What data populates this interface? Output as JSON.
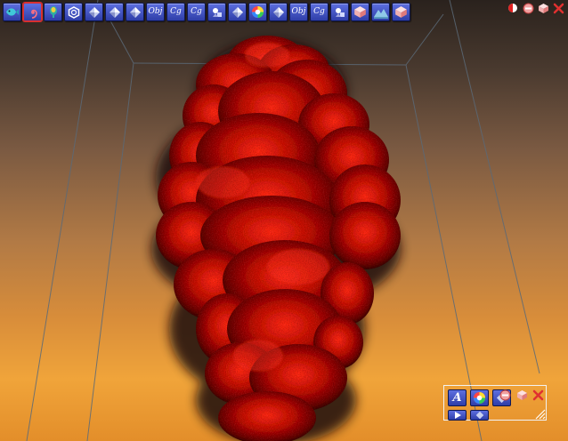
{
  "toolbar": {
    "buttons": [
      {
        "icon": "fish-icon",
        "label": ""
      },
      {
        "icon": "spiral-icon",
        "label": "",
        "active": true
      },
      {
        "icon": "figure-icon",
        "label": ""
      },
      {
        "icon": "hexagon-icon",
        "label": ""
      },
      {
        "icon": "diamond-icon",
        "label": ""
      },
      {
        "icon": "diamond-icon",
        "label": ""
      },
      {
        "icon": "diamond-icon",
        "label": ""
      },
      {
        "icon": "obj-text-icon",
        "label": "Obj"
      },
      {
        "icon": "cg-text-icon",
        "label": "Cg"
      },
      {
        "icon": "cg-text-icon",
        "label": "Cg"
      },
      {
        "icon": "shapes-icon",
        "label": ""
      },
      {
        "icon": "diamond-icon",
        "label": ""
      },
      {
        "icon": "color-wheel-icon",
        "label": ""
      },
      {
        "icon": "diamond-icon",
        "label": ""
      },
      {
        "icon": "obj-text-icon",
        "label": "Obj"
      },
      {
        "icon": "cg-text-icon",
        "label": "Cg"
      },
      {
        "icon": "shapes-icon",
        "label": ""
      },
      {
        "icon": "cube-pink-icon",
        "label": ""
      },
      {
        "icon": "terrain-icon",
        "label": ""
      },
      {
        "icon": "cube-pink-icon",
        "label": ""
      }
    ]
  },
  "window_controls": [
    {
      "icon": "sphere-icon"
    },
    {
      "icon": "minimize-icon"
    },
    {
      "icon": "cube-icon"
    },
    {
      "icon": "close-icon"
    }
  ],
  "mini_panel": {
    "text_label": "A",
    "buttons": [
      "text-icon",
      "color-wheel-icon",
      "diamond-icon",
      "arrow-icon",
      "diamond-icon"
    ],
    "controls": [
      "minimize-icon",
      "cube-icon",
      "close-icon"
    ]
  },
  "colors": {
    "button_top": "#5d6fe0",
    "button_bottom": "#2f3ea8",
    "smoke_red": "#b01010",
    "sky_orange": "#f0a43a",
    "close_red": "#e03030"
  }
}
